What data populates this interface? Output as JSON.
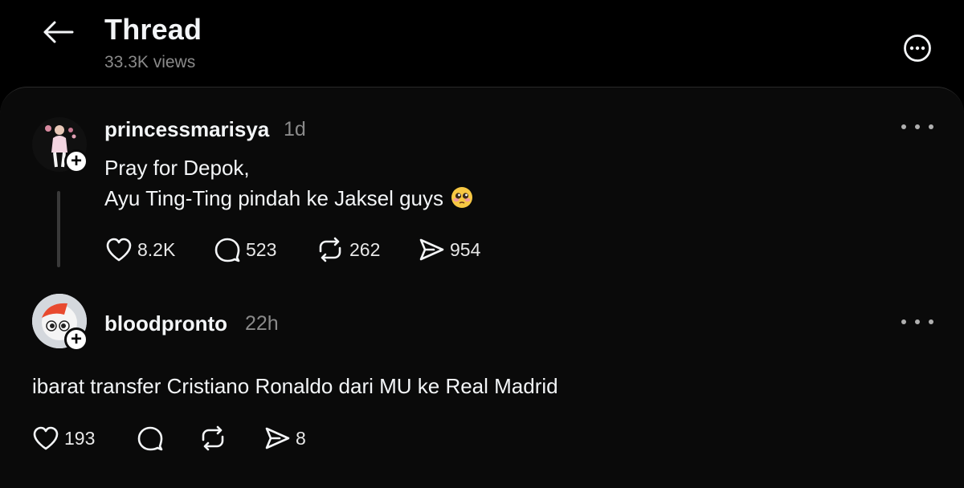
{
  "header": {
    "title": "Thread",
    "views": "33.3K views",
    "back_icon": "arrow-left-icon",
    "more_icon": "more-circle-icon"
  },
  "posts": [
    {
      "username": "princessmarisya",
      "time": "1d",
      "text_lines": [
        "Pray for Depok,",
        "Ayu Ting-Ting pindah ke Jaksel guys"
      ],
      "emoji": "pleading-face-emoji",
      "actions": {
        "likes": "8.2K",
        "replies": "523",
        "reposts": "262",
        "shares": "954"
      }
    },
    {
      "username": "bloodpronto",
      "time": "22h",
      "text": "ibarat transfer Cristiano Ronaldo dari MU ke Real Madrid",
      "actions": {
        "likes": "193",
        "replies": "",
        "reposts": "",
        "shares": "8"
      }
    }
  ],
  "colors": {
    "background": "#000000",
    "panel": "#0a0a0a",
    "text_primary": "#f3f5f7",
    "text_secondary": "#8a8a8a"
  }
}
